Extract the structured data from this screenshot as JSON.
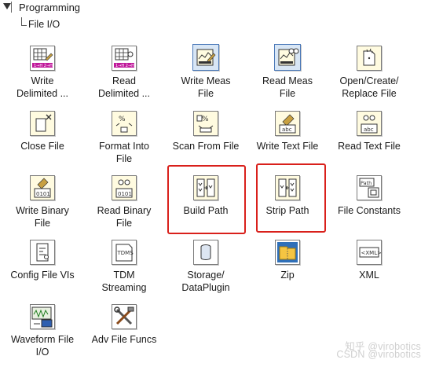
{
  "tree": {
    "category": "Programming",
    "subcategory": "File I/O"
  },
  "palette": [
    {
      "label": "Write\nDelimited ...",
      "icon": "grid-pencil-icon"
    },
    {
      "label": "Read\nDelimited ...",
      "icon": "grid-read-icon"
    },
    {
      "label": "Write Meas\nFile",
      "icon": "write-meas-icon"
    },
    {
      "label": "Read Meas\nFile",
      "icon": "read-meas-icon"
    },
    {
      "label": "Open/Create/\nReplace File",
      "icon": "file-open-icon"
    },
    {
      "label": "Close File",
      "icon": "close-file-icon"
    },
    {
      "label": "Format Into\nFile",
      "icon": "format-file-icon"
    },
    {
      "label": "Scan From File",
      "icon": "scan-file-icon"
    },
    {
      "label": "Write Text File",
      "icon": "write-text-icon"
    },
    {
      "label": "Read Text File",
      "icon": "read-text-icon"
    },
    {
      "label": "Write Binary\nFile",
      "icon": "write-binary-icon"
    },
    {
      "label": "Read Binary\nFile",
      "icon": "read-binary-icon"
    },
    {
      "label": "Build Path",
      "icon": "build-path-icon"
    },
    {
      "label": "Strip Path",
      "icon": "strip-path-icon"
    },
    {
      "label": "File Constants",
      "icon": "path-constant-icon"
    },
    {
      "label": "Config File VIs",
      "icon": "config-file-icon"
    },
    {
      "label": "TDM\nStreaming",
      "icon": "tdm-icon"
    },
    {
      "label": "Storage/\nDataPlugin",
      "icon": "storage-icon"
    },
    {
      "label": "Zip",
      "icon": "zip-icon"
    },
    {
      "label": "XML",
      "icon": "xml-icon"
    },
    {
      "label": "Waveform File\nI/O",
      "icon": "waveform-file-icon"
    },
    {
      "label": "Adv File Funcs",
      "icon": "tools-icon"
    }
  ],
  "watermark": {
    "line1": "知乎 @virobotics",
    "line2": "CSDN @virobotics"
  },
  "colors": {
    "highlight": "#d9201b",
    "icon_bg": "#fffbe0",
    "selected_bg": "#d8e6f5"
  }
}
